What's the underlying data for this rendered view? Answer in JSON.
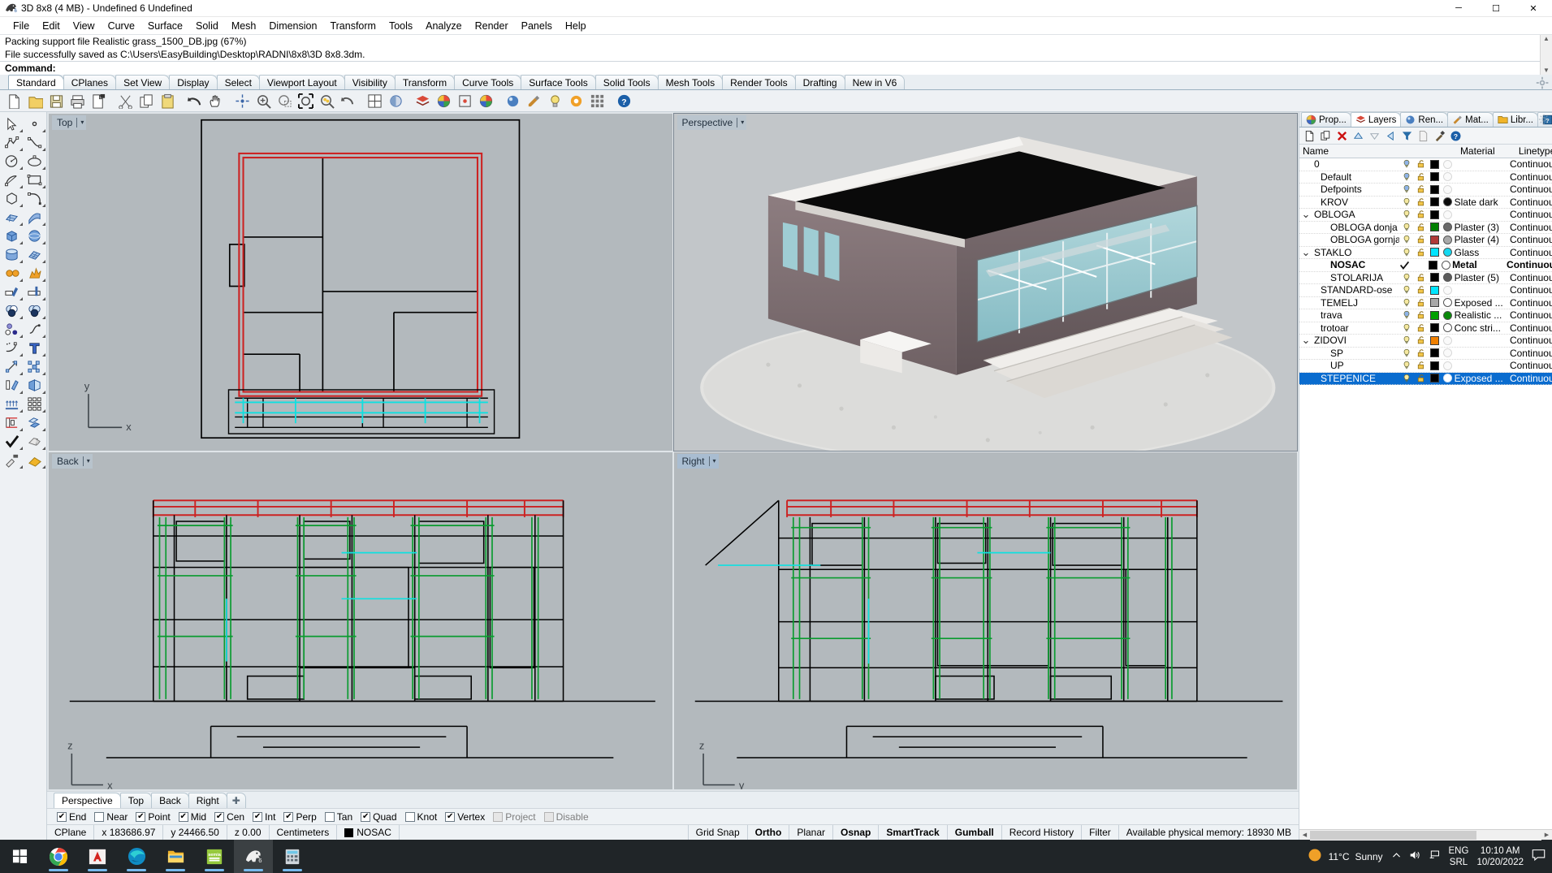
{
  "window": {
    "title": "3D 8x8 (4 MB) - Undefined 6 Undefined",
    "app_icon": "rhino-icon",
    "minimize": "─",
    "maximize": "☐",
    "close": "✕"
  },
  "menu": {
    "items": [
      "File",
      "Edit",
      "View",
      "Curve",
      "Surface",
      "Solid",
      "Mesh",
      "Dimension",
      "Transform",
      "Tools",
      "Analyze",
      "Render",
      "Panels",
      "Help"
    ]
  },
  "command": {
    "history_line1": "Packing support file Realistic grass_1500_DB.jpg (67%)",
    "history_line2": "File successfully saved as C:\\Users\\EasyBuilding\\Desktop\\RADNI\\8x8\\3D 8x8.3dm.",
    "prompt_label": "Command:",
    "input_value": "",
    "input_placeholder": ""
  },
  "toolbar_tabs": {
    "active": "Standard",
    "items": [
      "Standard",
      "CPlanes",
      "Set View",
      "Display",
      "Select",
      "Viewport Layout",
      "Visibility",
      "Transform",
      "Curve Tools",
      "Surface Tools",
      "Solid Tools",
      "Mesh Tools",
      "Render Tools",
      "Drafting",
      "New in V6"
    ]
  },
  "main_toolbar": {
    "buttons": [
      "new-file-icon",
      "open-folder-icon",
      "save-icon",
      "print-icon",
      "save-as-icon",
      "cut-scissors-icon",
      "copy-icon",
      "paste-icon",
      "undo-arrow-icon",
      "pan-hand-icon",
      "rotate-view-icon",
      "zoom-in-icon",
      "zoom-window-icon",
      "zoom-extents-icon",
      "zoom-selected-icon",
      "zoom-previous-icon",
      "viewport-layout-icon",
      "shaded-view-icon",
      "layers-icon",
      "properties-icon",
      "object-snap-icon",
      "color-wheel-icon",
      "render-sphere-icon",
      "material-icon",
      "light-bulb-icon",
      "render-icon",
      "grid-snap-icon",
      "help-icon"
    ]
  },
  "left_toolbar": {
    "buttons": [
      [
        "select-arrow-icon",
        "point-icon"
      ],
      [
        "polyline-icon",
        "control-point-curve-icon"
      ],
      [
        "circle-icon",
        "ellipse-icon"
      ],
      [
        "arc-icon",
        "rectangle-icon"
      ],
      [
        "polygon-icon",
        "curve-fillet-icon"
      ],
      [
        "surface-from-points-icon",
        "extrude-surface-icon"
      ],
      [
        "box-icon",
        "sphere-icon"
      ],
      [
        "cylinder-icon",
        "surface-mesh-icon"
      ],
      [
        "boolean-union-icon",
        "explode-icon"
      ],
      [
        "trim-icon",
        "split-icon"
      ],
      [
        "boolean-difference-icon",
        "boolean-intersection-icon"
      ],
      [
        "join-icon",
        "curve-blend-icon"
      ],
      [
        "fillet-curve-icon",
        "text-tool-icon"
      ],
      [
        "move-icon",
        "copy-objects-icon"
      ],
      [
        "rotate-icon",
        "mirror-icon"
      ],
      [
        "array-linear-icon",
        "array-grid-icon"
      ],
      [
        "scale-icon",
        "offset-surface-icon"
      ],
      [
        "check-objects-icon",
        "silhouette-icon"
      ],
      [
        "paint-dropper-icon",
        "fill-tool-icon"
      ]
    ]
  },
  "viewports": [
    {
      "name": "Top",
      "caret": "▾",
      "active": false,
      "axes": {
        "h": "x",
        "v": "y"
      }
    },
    {
      "name": "Perspective",
      "caret": "▾",
      "active": true,
      "axes": {
        "h": "",
        "v": ""
      }
    },
    {
      "name": "Back",
      "caret": "▾",
      "active": false,
      "axes": {
        "h": "x",
        "v": "z"
      }
    },
    {
      "name": "Right",
      "caret": "▾",
      "active": false,
      "axes": {
        "h": "y",
        "v": "z"
      }
    }
  ],
  "viewport_tabs": {
    "active": "Perspective",
    "items": [
      "Perspective",
      "Top",
      "Back",
      "Right"
    ],
    "add_label": "✚"
  },
  "osnap": {
    "items": [
      {
        "label": "End",
        "checked": true,
        "disabled": false
      },
      {
        "label": "Near",
        "checked": false,
        "disabled": false
      },
      {
        "label": "Point",
        "checked": true,
        "disabled": false
      },
      {
        "label": "Mid",
        "checked": true,
        "disabled": false
      },
      {
        "label": "Cen",
        "checked": true,
        "disabled": false
      },
      {
        "label": "Int",
        "checked": true,
        "disabled": false
      },
      {
        "label": "Perp",
        "checked": true,
        "disabled": false
      },
      {
        "label": "Tan",
        "checked": false,
        "disabled": false
      },
      {
        "label": "Quad",
        "checked": true,
        "disabled": false
      },
      {
        "label": "Knot",
        "checked": false,
        "disabled": false
      },
      {
        "label": "Vertex",
        "checked": true,
        "disabled": false
      },
      {
        "label": "Project",
        "checked": false,
        "disabled": true
      },
      {
        "label": "Disable",
        "checked": false,
        "disabled": true
      }
    ]
  },
  "statusbar": {
    "cplane": "CPlane",
    "x": "x 183686.97",
    "y": "y 24466.50",
    "z": "z 0.00",
    "units": "Centimeters",
    "layer": "NOSAC",
    "layer_color": "#000000",
    "grid_snap": "Grid Snap",
    "ortho": "Ortho",
    "planar": "Planar",
    "osnap": "Osnap",
    "smarttrack": "SmartTrack",
    "gumball": "Gumball",
    "record_history": "Record History",
    "filter": "Filter",
    "memory": "Available physical memory: 18930 MB"
  },
  "right_panel": {
    "tabs": [
      {
        "label": "Prop...",
        "icon": "color-wheel-icon",
        "active": false
      },
      {
        "label": "Layers",
        "icon": "layers-icon",
        "active": true
      },
      {
        "label": "Ren...",
        "icon": "render-sphere-icon",
        "active": false
      },
      {
        "label": "Mat...",
        "icon": "material-brush-icon",
        "active": false
      },
      {
        "label": "Libr...",
        "icon": "folder-icon",
        "active": false
      },
      {
        "label": "Help",
        "icon": "help-icon",
        "active": false
      }
    ],
    "gear": "gear-icon",
    "toolbar": [
      "new-layer-icon",
      "copy-layer-icon",
      "delete-layer-icon",
      "move-up-icon",
      "move-down-icon",
      "move-left-icon",
      "filter-icon",
      "layer-properties-icon",
      "layer-tools-icon",
      "help-icon"
    ],
    "columns": [
      "Name",
      "",
      "",
      "",
      "",
      "Material",
      "Linetype"
    ],
    "layers": [
      {
        "name": "0",
        "indent": 0,
        "expander": "",
        "bulb": "on-blue",
        "lock": "unlocked",
        "color": "#000000",
        "material": "",
        "mat_color": "",
        "linetype": "Continuous",
        "current": false,
        "selected": false
      },
      {
        "name": "Default",
        "indent": 1,
        "expander": "",
        "bulb": "on-blue",
        "lock": "unlocked",
        "color": "#000000",
        "material": "",
        "mat_color": "",
        "linetype": "Continuous",
        "current": false,
        "selected": false
      },
      {
        "name": "Defpoints",
        "indent": 1,
        "expander": "",
        "bulb": "on-blue",
        "lock": "unlocked",
        "color": "#000000",
        "material": "",
        "mat_color": "",
        "linetype": "Continuous",
        "current": false,
        "selected": false
      },
      {
        "name": "KROV",
        "indent": 1,
        "expander": "",
        "bulb": "on",
        "lock": "unlocked",
        "color": "#000000",
        "material": "Slate dark",
        "mat_color": "#0b0b0b",
        "linetype": "Continuous",
        "current": false,
        "selected": false
      },
      {
        "name": "OBLOGA",
        "indent": 0,
        "expander": "v",
        "bulb": "on",
        "lock": "unlocked",
        "color": "#000000",
        "material": "",
        "mat_color": "",
        "linetype": "Continuous",
        "current": false,
        "selected": false
      },
      {
        "name": "OBLOGA donja",
        "indent": 2,
        "expander": "",
        "bulb": "on",
        "lock": "unlocked",
        "color": "#008000",
        "material": "Plaster (3)",
        "mat_color": "#6b6b6b",
        "linetype": "Continuous",
        "current": false,
        "selected": false
      },
      {
        "name": "OBLOGA gornja",
        "indent": 2,
        "expander": "",
        "bulb": "on",
        "lock": "unlocked",
        "color": "#b03a38",
        "material": "Plaster (4)",
        "mat_color": "#a9a9a9",
        "linetype": "Continuous",
        "current": false,
        "selected": false
      },
      {
        "name": "STAKLO",
        "indent": 0,
        "expander": "v",
        "bulb": "on",
        "lock": "unlocked",
        "color": "#00e5ff",
        "material": "Glass",
        "mat_color": "#14d8f0",
        "linetype": "Continuous",
        "current": false,
        "selected": false
      },
      {
        "name": "NOSAC",
        "indent": 2,
        "expander": "",
        "bulb": "check",
        "lock": "",
        "color": "#000000",
        "material": "Metal",
        "mat_color": "#ffffff",
        "linetype": "Continuous",
        "current": true,
        "selected": false
      },
      {
        "name": "STOLARIJA",
        "indent": 2,
        "expander": "",
        "bulb": "on",
        "lock": "unlocked",
        "color": "#000000",
        "material": "Plaster (5)",
        "mat_color": "#5c5c5c",
        "linetype": "Continuous",
        "current": false,
        "selected": false
      },
      {
        "name": "STANDARD-ose",
        "indent": 1,
        "expander": "",
        "bulb": "on",
        "lock": "unlocked",
        "color": "#00e5ff",
        "material": "",
        "mat_color": "",
        "linetype": "Continuous",
        "current": false,
        "selected": false
      },
      {
        "name": "TEMELJ",
        "indent": 1,
        "expander": "",
        "bulb": "on",
        "lock": "unlocked",
        "color": "#a8a8a8",
        "material": "Exposed ...",
        "mat_color": "#ffffff",
        "linetype": "Continuous",
        "current": false,
        "selected": false
      },
      {
        "name": "trava",
        "indent": 1,
        "expander": "",
        "bulb": "on-blue",
        "lock": "unlocked",
        "color": "#00a000",
        "material": "Realistic ...",
        "mat_color": "#0a8a0a",
        "linetype": "Continuous",
        "current": false,
        "selected": false
      },
      {
        "name": "trotoar",
        "indent": 1,
        "expander": "",
        "bulb": "on",
        "lock": "unlocked",
        "color": "#000000",
        "material": "Conc stri...",
        "mat_color": "#ffffff",
        "linetype": "Continuous",
        "current": false,
        "selected": false
      },
      {
        "name": "ZIDOVI",
        "indent": 0,
        "expander": "v",
        "bulb": "on",
        "lock": "unlocked",
        "color": "#f08000",
        "material": "",
        "mat_color": "",
        "linetype": "Continuous",
        "current": false,
        "selected": false
      },
      {
        "name": "SP",
        "indent": 2,
        "expander": "",
        "bulb": "on",
        "lock": "unlocked",
        "color": "#000000",
        "material": "",
        "mat_color": "",
        "linetype": "Continuous",
        "current": false,
        "selected": false
      },
      {
        "name": "UP",
        "indent": 2,
        "expander": "",
        "bulb": "on",
        "lock": "unlocked",
        "color": "#000000",
        "material": "",
        "mat_color": "",
        "linetype": "Continuous",
        "current": false,
        "selected": false
      },
      {
        "name": "STEPENICE",
        "indent": 1,
        "expander": "",
        "bulb": "on",
        "lock": "unlocked",
        "color": "#000000",
        "material": "Exposed ...",
        "mat_color": "#ffffff",
        "linetype": "Continuous",
        "current": false,
        "selected": true
      }
    ]
  },
  "taskbar": {
    "start": "windows-start-icon",
    "apps": [
      "chrome-icon",
      "autocad-icon",
      "edge-icon",
      "file-explorer-icon",
      "semia-icon",
      "rhino-icon",
      "calculator-icon"
    ],
    "weather_temp": "11°C",
    "weather_desc": "Sunny",
    "show_hidden": "chevron-up-icon",
    "volume": "speaker-icon",
    "network": "network-icon",
    "lang_line1": "ENG",
    "lang_line2": "SRL",
    "time": "10:10 AM",
    "date": "10/20/2022",
    "notifications": "notification-icon"
  },
  "colors": {
    "accent": "#0a6ccf",
    "viewport_bg": "#b3b9bd",
    "panel_bg": "#eef1f4",
    "taskbar_bg": "#202528"
  }
}
